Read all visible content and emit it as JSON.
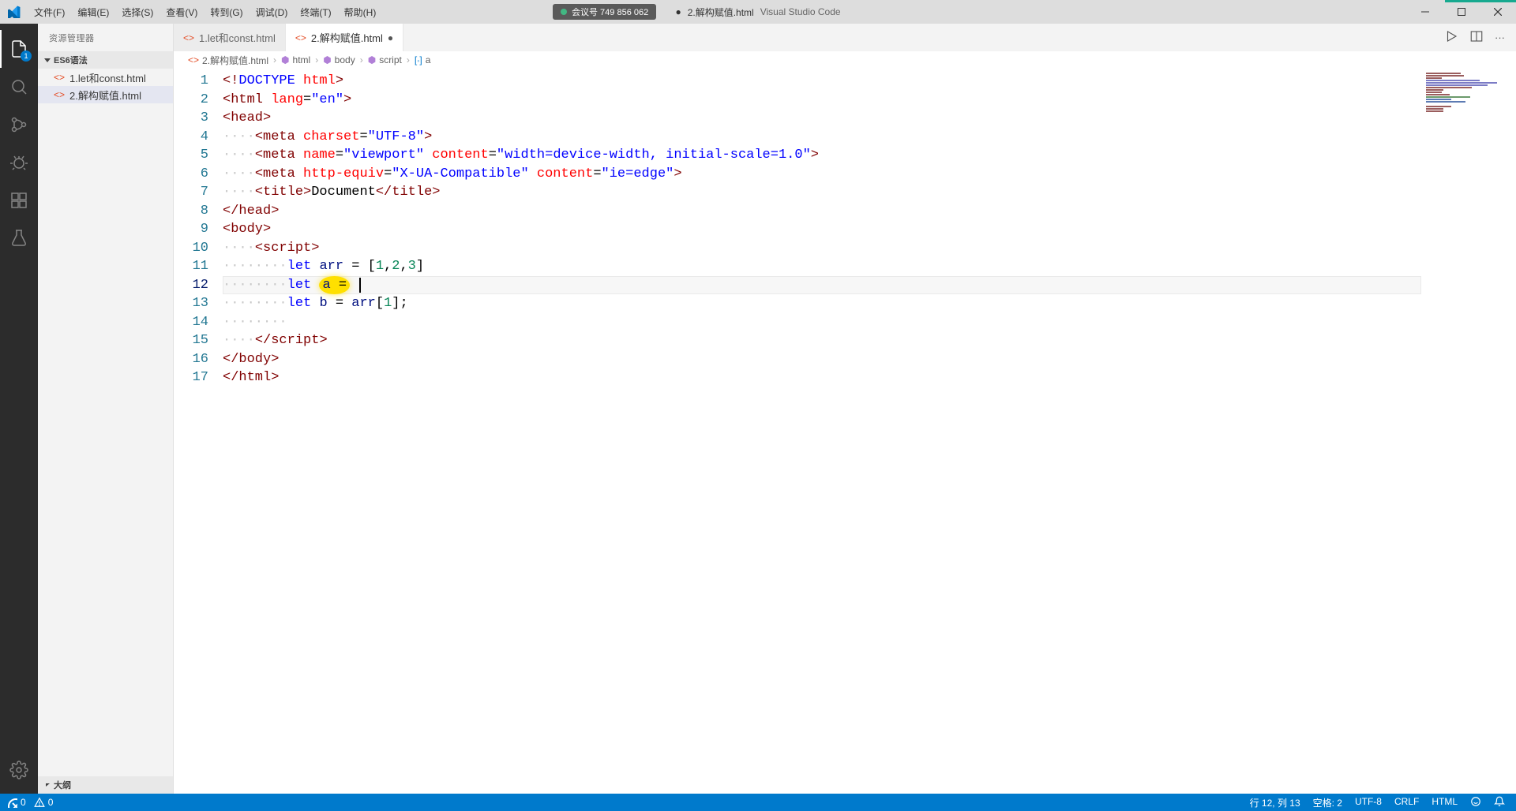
{
  "title": {
    "app": "Visual Studio Code",
    "file_dirty": "2.解构赋值.html",
    "meeting_badge": "会议号 749 856 062"
  },
  "menu": {
    "file": "文件(F)",
    "edit": "编辑(E)",
    "select": "选择(S)",
    "view": "查看(V)",
    "goto": "转到(G)",
    "debug": "调试(D)",
    "terminal": "终端(T)",
    "help": "帮助(H)"
  },
  "activitybar": {
    "explorer_badge": "1"
  },
  "sidebar": {
    "title": "资源管理器",
    "section": "ES6语法",
    "outline": "大纲",
    "files": [
      {
        "name": "1.let和const.html"
      },
      {
        "name": "2.解构赋值.html"
      }
    ]
  },
  "tabs": [
    {
      "label": "1.let和const.html",
      "dirty": false,
      "active": false
    },
    {
      "label": "2.解构赋值.html",
      "dirty": true,
      "active": true
    }
  ],
  "breadcrumbs": {
    "b0": "2.解构赋值.html",
    "b1": "html",
    "b2": "body",
    "b3": "script",
    "b4": "a"
  },
  "code": {
    "line_count": 17,
    "current_line": 12,
    "l1": "<!DOCTYPE html>",
    "l7_title_text": "Document"
  },
  "statusbar": {
    "errors": "0",
    "warnings": "0",
    "line_col": "行 12, 列 13",
    "spaces": "空格: 2",
    "encoding": "UTF-8",
    "eol": "CRLF",
    "lang": "HTML"
  }
}
